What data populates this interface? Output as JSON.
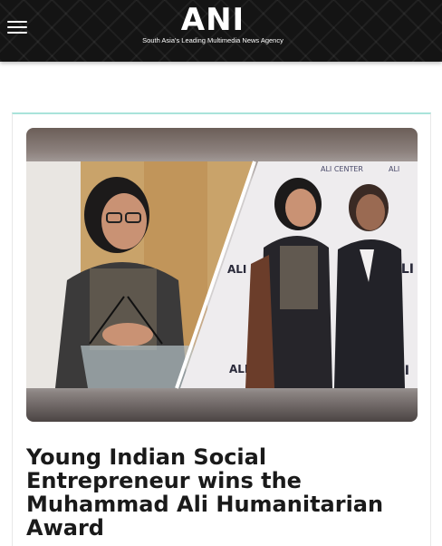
{
  "header": {
    "logo_text": "ANI",
    "tagline": "South Asia's Leading Multimedia News Agency",
    "background_color": "#141414"
  },
  "nav": {
    "menu_icon": "hamburger-menu-icon"
  },
  "article": {
    "accent_color": "#a9e3da",
    "headline": "Young Indian Social Entrepreneur wins the Muhammad Ali Humanitarian Award",
    "image": {
      "backdrop_logo": "ALI",
      "backdrop_logo_sub": "CENTER"
    }
  }
}
